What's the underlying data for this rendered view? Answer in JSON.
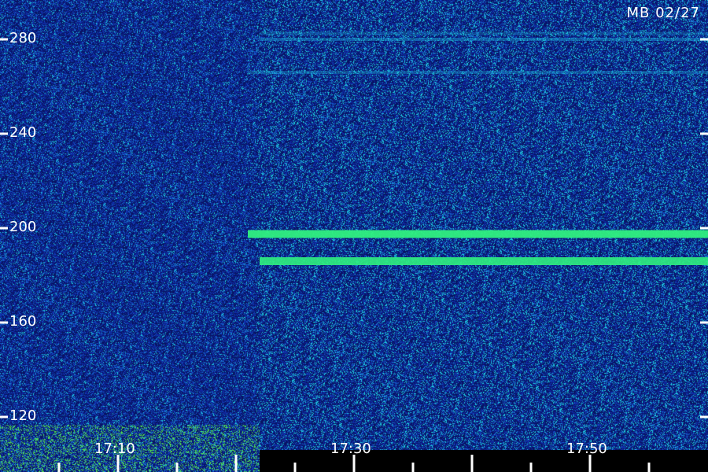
{
  "stamp": "MB 02/27",
  "chart_data": {
    "type": "heatmap",
    "title": "",
    "xlabel": "",
    "ylabel": "",
    "y_ticks": [
      "280",
      "240",
      "200",
      "160",
      "120"
    ],
    "x_ticks": [
      "17:10",
      "17:30",
      "17:50"
    ],
    "ylim": [
      110,
      295
    ],
    "xlim": [
      "17:00",
      "18:00"
    ],
    "grid": false,
    "colors": {
      "background": "#0a1a66",
      "noise_low": "#1030b0",
      "noise_high": "#20c8e8",
      "signal": "#30f080",
      "text": "#ffffff"
    },
    "signals": [
      {
        "y": 197.5,
        "x_start": "17:21",
        "x_end": "18:00",
        "strength": 0.95
      },
      {
        "y": 186,
        "x_start": "17:22",
        "x_end": "18:00",
        "strength": 0.9
      },
      {
        "y": 280,
        "x_start": "17:22",
        "x_end": "18:00",
        "strength": 0.35
      },
      {
        "y": 266,
        "x_start": "17:21",
        "x_end": "18:00",
        "strength": 0.3
      },
      {
        "y": 282.5,
        "x_start": "17:22",
        "x_end": "18:00",
        "strength": 0.25
      }
    ]
  }
}
